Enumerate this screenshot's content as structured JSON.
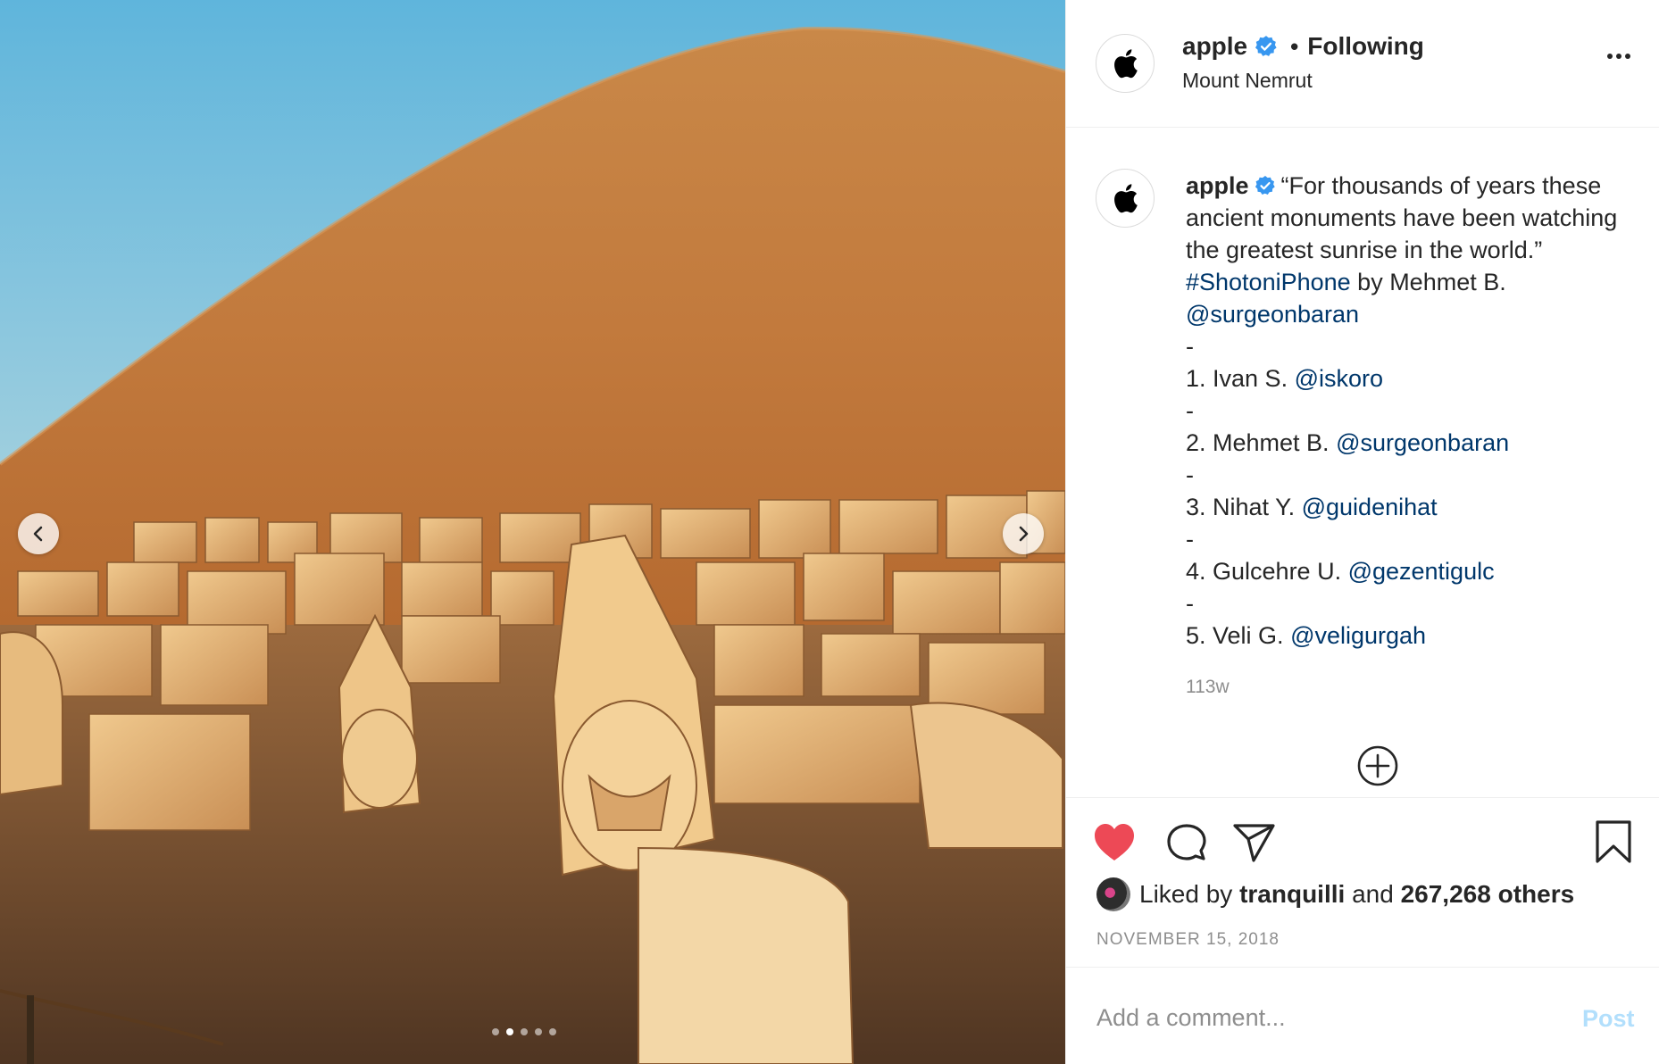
{
  "post": {
    "username": "apple",
    "follow_status": "Following",
    "separator": "•",
    "location": "Mount Nemrut"
  },
  "caption": {
    "username": "apple",
    "text_intro": "“For thousands of years these ancient monuments have been watching the greatest sunrise in the world.” ",
    "hashtag": "#ShotoniPhone",
    "by_text": " by Mehmet B. ",
    "by_handle": "@surgeonbaran",
    "dash": "-",
    "credits": [
      {
        "label": "1. Ivan S. ",
        "handle": "@iskoro"
      },
      {
        "label": "2. Mehmet B. ",
        "handle": "@surgeonbaran"
      },
      {
        "label": "3. Nihat Y. ",
        "handle": "@guidenihat"
      },
      {
        "label": "4. Gulcehre U. ",
        "handle": "@gezentigulc"
      },
      {
        "label": "5. Veli G. ",
        "handle": "@veligurgah"
      }
    ],
    "age": "113w"
  },
  "likes": {
    "prefix": "Liked by ",
    "user": "tranquilli",
    "middle": " and ",
    "count": "267,268 others"
  },
  "date": "NOVEMBER 15, 2018",
  "comment": {
    "placeholder": "Add a comment...",
    "post_label": "Post"
  },
  "carousel": {
    "total_slides": 5,
    "active_slide": 2
  },
  "colors": {
    "link": "#00376b",
    "heart": "#ed4956",
    "verified": "#3897f0",
    "post_disabled": "#b2dffc"
  },
  "icons": [
    "apple-logo-icon",
    "verified-badge-icon",
    "more-options-icon",
    "heart-icon",
    "comment-icon",
    "share-icon",
    "bookmark-icon",
    "add-circle-icon",
    "chevron-left-icon",
    "chevron-right-icon"
  ]
}
